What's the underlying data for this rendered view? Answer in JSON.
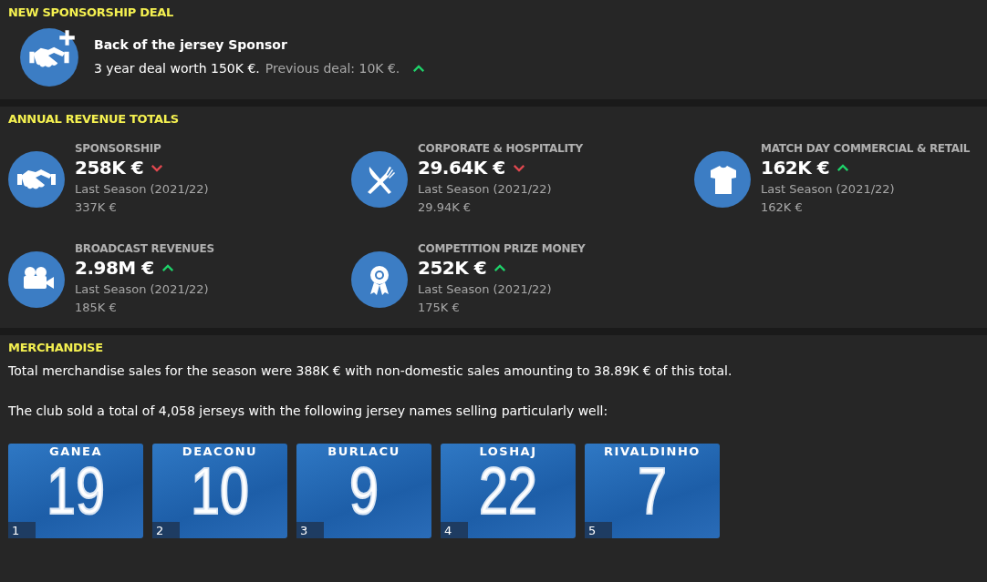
{
  "new_deal": {
    "heading": "NEW SPONSORSHIP DEAL",
    "title": "Back of the jersey Sponsor",
    "deal": "3 year deal worth 150K €.",
    "previous": "Previous deal: 10K €.",
    "rising": true
  },
  "revenue": {
    "heading": "ANNUAL REVENUE TOTALS",
    "items": [
      {
        "label": "SPONSORSHIP",
        "value": "258K €",
        "rising": false,
        "last_label": "Last Season (2021/22)",
        "last_value": "337K €"
      },
      {
        "label": "CORPORATE & HOSPITALITY",
        "value": "29.64K €",
        "rising": false,
        "last_label": "Last Season (2021/22)",
        "last_value": "29.94K €"
      },
      {
        "label": "MATCH DAY COMMERCIAL & RETAIL",
        "value": "162K €",
        "rising": true,
        "last_label": "Last Season (2021/22)",
        "last_value": "162K €"
      },
      {
        "label": "BROADCAST REVENUES",
        "value": "2.98M €",
        "rising": true,
        "last_label": "Last Season (2021/22)",
        "last_value": "185K €"
      },
      {
        "label": "COMPETITION PRIZE MONEY",
        "value": "252K €",
        "rising": true,
        "last_label": "Last Season (2021/22)",
        "last_value": "175K €"
      }
    ]
  },
  "merchandise": {
    "heading": "MERCHANDISE",
    "summary": "Total merchandise sales for the season were 388K € with non-domestic sales amounting to 38.89K € of this total.",
    "jersey_intro": "The club sold a total of 4,058 jerseys with the following jersey names selling particularly well:",
    "jerseys": [
      {
        "name": "GANEA",
        "number": "19",
        "rank": "1"
      },
      {
        "name": "DEACONU",
        "number": "10",
        "rank": "2"
      },
      {
        "name": "BURLACU",
        "number": "9",
        "rank": "3"
      },
      {
        "name": "LOSHAJ",
        "number": "22",
        "rank": "4"
      },
      {
        "name": "RIVALDINHO",
        "number": "7",
        "rank": "5"
      }
    ]
  }
}
